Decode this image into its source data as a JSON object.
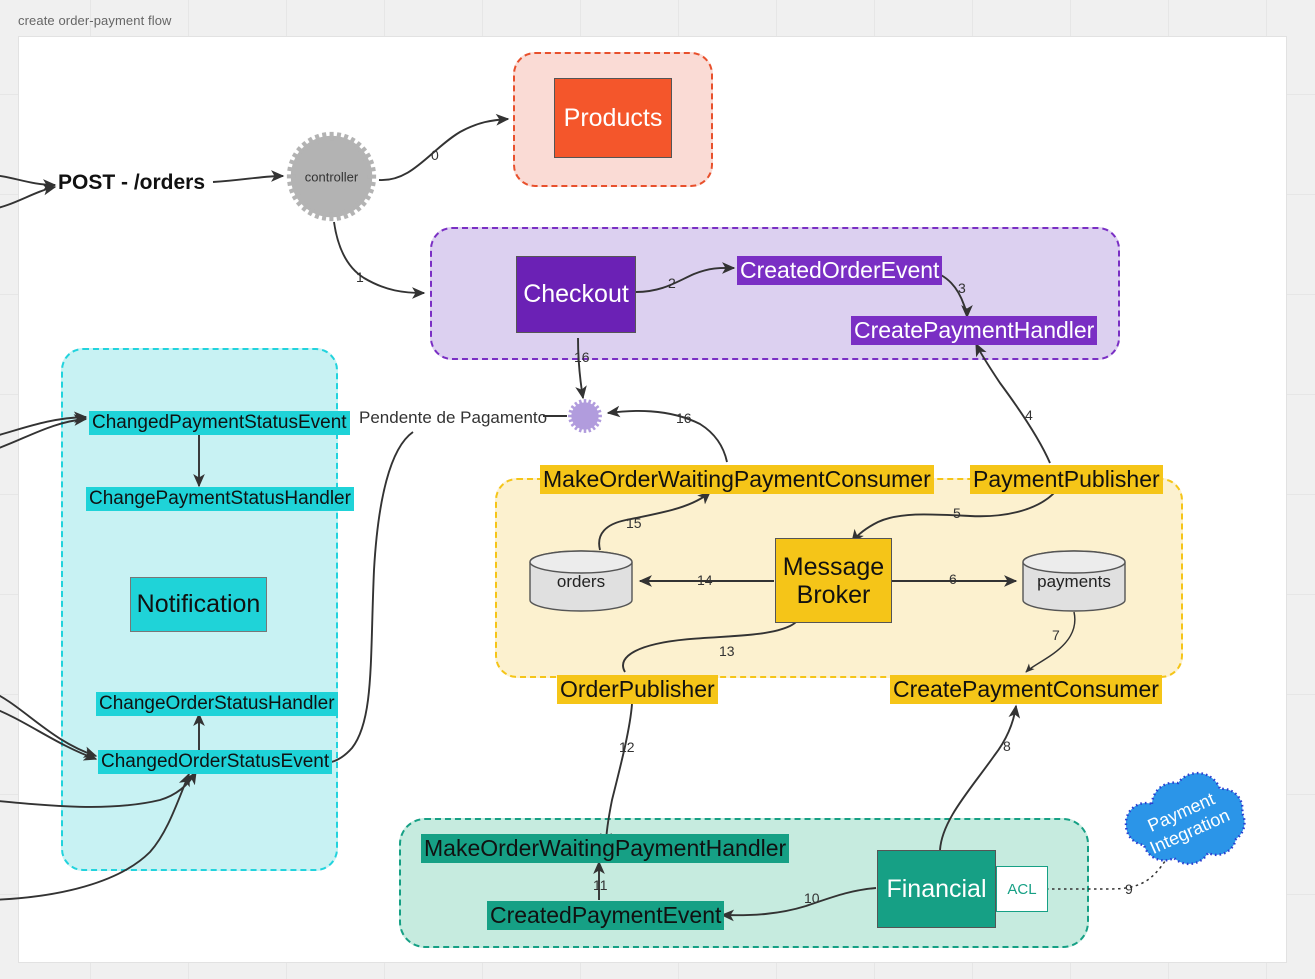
{
  "canvas": {
    "title": "create order-payment flow"
  },
  "entry": {
    "label": "POST - /orders"
  },
  "notes": {
    "pendente": "Pendente de Pagamento"
  },
  "gears": [
    {
      "name": "controller",
      "label": "controller"
    },
    {
      "name": "order-status-gear",
      "label": ""
    }
  ],
  "groups": {
    "products": {
      "title": "",
      "box": "Products"
    },
    "checkout": {
      "box": "Checkout",
      "created_order_event": "CreatedOrderEvent",
      "create_payment_handler": "CreatePaymentHandler"
    },
    "notification": {
      "changed_payment_status_event": "ChangedPaymentStatusEvent",
      "change_payment_status_handler": "ChangePaymentStatusHandler",
      "notification_box": "Notification",
      "change_order_status_handler": "ChangeOrderStatusHandler",
      "changed_order_status_event": "ChangedOrderStatusEvent"
    },
    "broker": {
      "make_order_waiting_payment_consumer": "MakeOrderWaitingPaymentConsumer",
      "payment_publisher": "PaymentPublisher",
      "order_publisher": "OrderPublisher",
      "create_payment_consumer": "CreatePaymentConsumer",
      "message_broker": "Message Broker",
      "db_orders": "orders",
      "db_payments": "payments"
    },
    "financial": {
      "make_order_waiting_payment_handler": "MakeOrderWaitingPaymentHandler",
      "created_payment_event": "CreatedPaymentEvent",
      "financial_box": "Financial",
      "acl_box": "ACL"
    },
    "external": {
      "cloud_line1": "Payment",
      "cloud_line2": "Integration"
    }
  },
  "edge_labels": {
    "e0": "0",
    "e1": "1",
    "e2": "2",
    "e3": "3",
    "e4": "4",
    "e5": "5",
    "e6": "6",
    "e7": "7",
    "e8": "8",
    "e9": "9",
    "e10": "10",
    "e11": "11",
    "e12": "12",
    "e13": "13",
    "e14": "14",
    "e15": "15",
    "e16a": "16",
    "e16b": "16"
  },
  "colors": {
    "products_fill": "#f4562b",
    "products_group": "#fadbd5",
    "products_border": "#e8502c",
    "checkout_fill": "#6b21b5",
    "checkout_group": "#dcd0f0",
    "checkout_border": "#7a2fc4",
    "notify_fill": "#1fd3d8",
    "notify_group": "#c8f2f3",
    "notify_border": "#22d3dd",
    "broker_fill": "#f5c518",
    "broker_group": "#fcf1cf",
    "financial_fill": "#16a085",
    "financial_group": "#c6ebdf",
    "cloud_fill": "#2b95e8",
    "cloud_border": "#2a3fd0",
    "gear_fill": "#b3b3b3",
    "gear_purple": "#b19cdd",
    "db_fill": "#e0e0e0",
    "canvas_bg": "#ffffff",
    "page_bg": "#f0f0f0"
  }
}
